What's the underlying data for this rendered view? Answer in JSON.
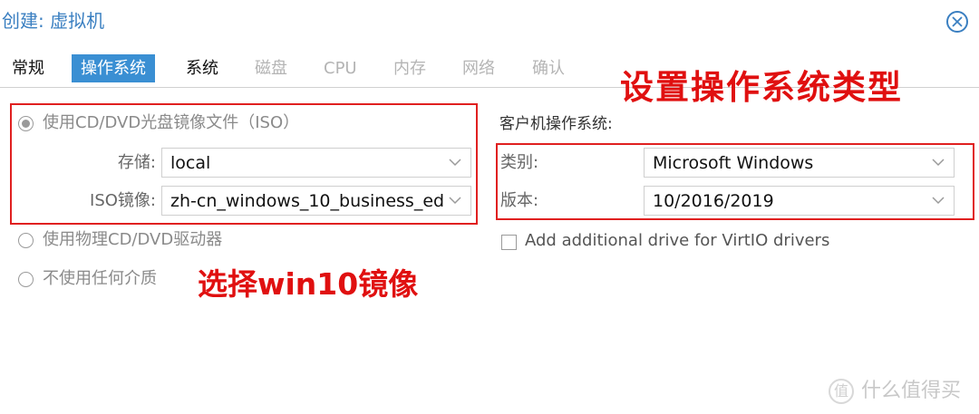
{
  "dialog": {
    "title": "创建: 虚拟机",
    "close_icon": "close-circle-icon"
  },
  "tabs": [
    {
      "label": "常规",
      "state": "enabled"
    },
    {
      "label": "操作系统",
      "state": "active"
    },
    {
      "label": "系统",
      "state": "enabled"
    },
    {
      "label": "磁盘",
      "state": "disabled"
    },
    {
      "label": "CPU",
      "state": "disabled"
    },
    {
      "label": "内存",
      "state": "disabled"
    },
    {
      "label": "网络",
      "state": "disabled"
    },
    {
      "label": "确认",
      "state": "disabled"
    }
  ],
  "media": {
    "option_iso": "使用CD/DVD光盘镜像文件（ISO）",
    "storage_label": "存储:",
    "storage_value": "local",
    "iso_label": "ISO镜像:",
    "iso_value": "zh-cn_windows_10_business_ed",
    "option_physical": "使用物理CD/DVD驱动器",
    "option_none": "不使用任何介质"
  },
  "guest_os": {
    "section_label": "客户机操作系统:",
    "type_label": "类别:",
    "type_value": "Microsoft Windows",
    "version_label": "版本:",
    "version_value": "10/2016/2019",
    "virtio_label": "Add additional drive for VirtIO drivers",
    "virtio_checked": false
  },
  "annotations": {
    "right": "设置操作系统类型",
    "left": "选择win10镜像",
    "color": "#e02020"
  },
  "watermark": {
    "badge": "值",
    "text": "什么值得买"
  },
  "colors": {
    "accent": "#3a8fd3",
    "title": "#3a7fc1",
    "disabled": "#b4b4b4"
  }
}
